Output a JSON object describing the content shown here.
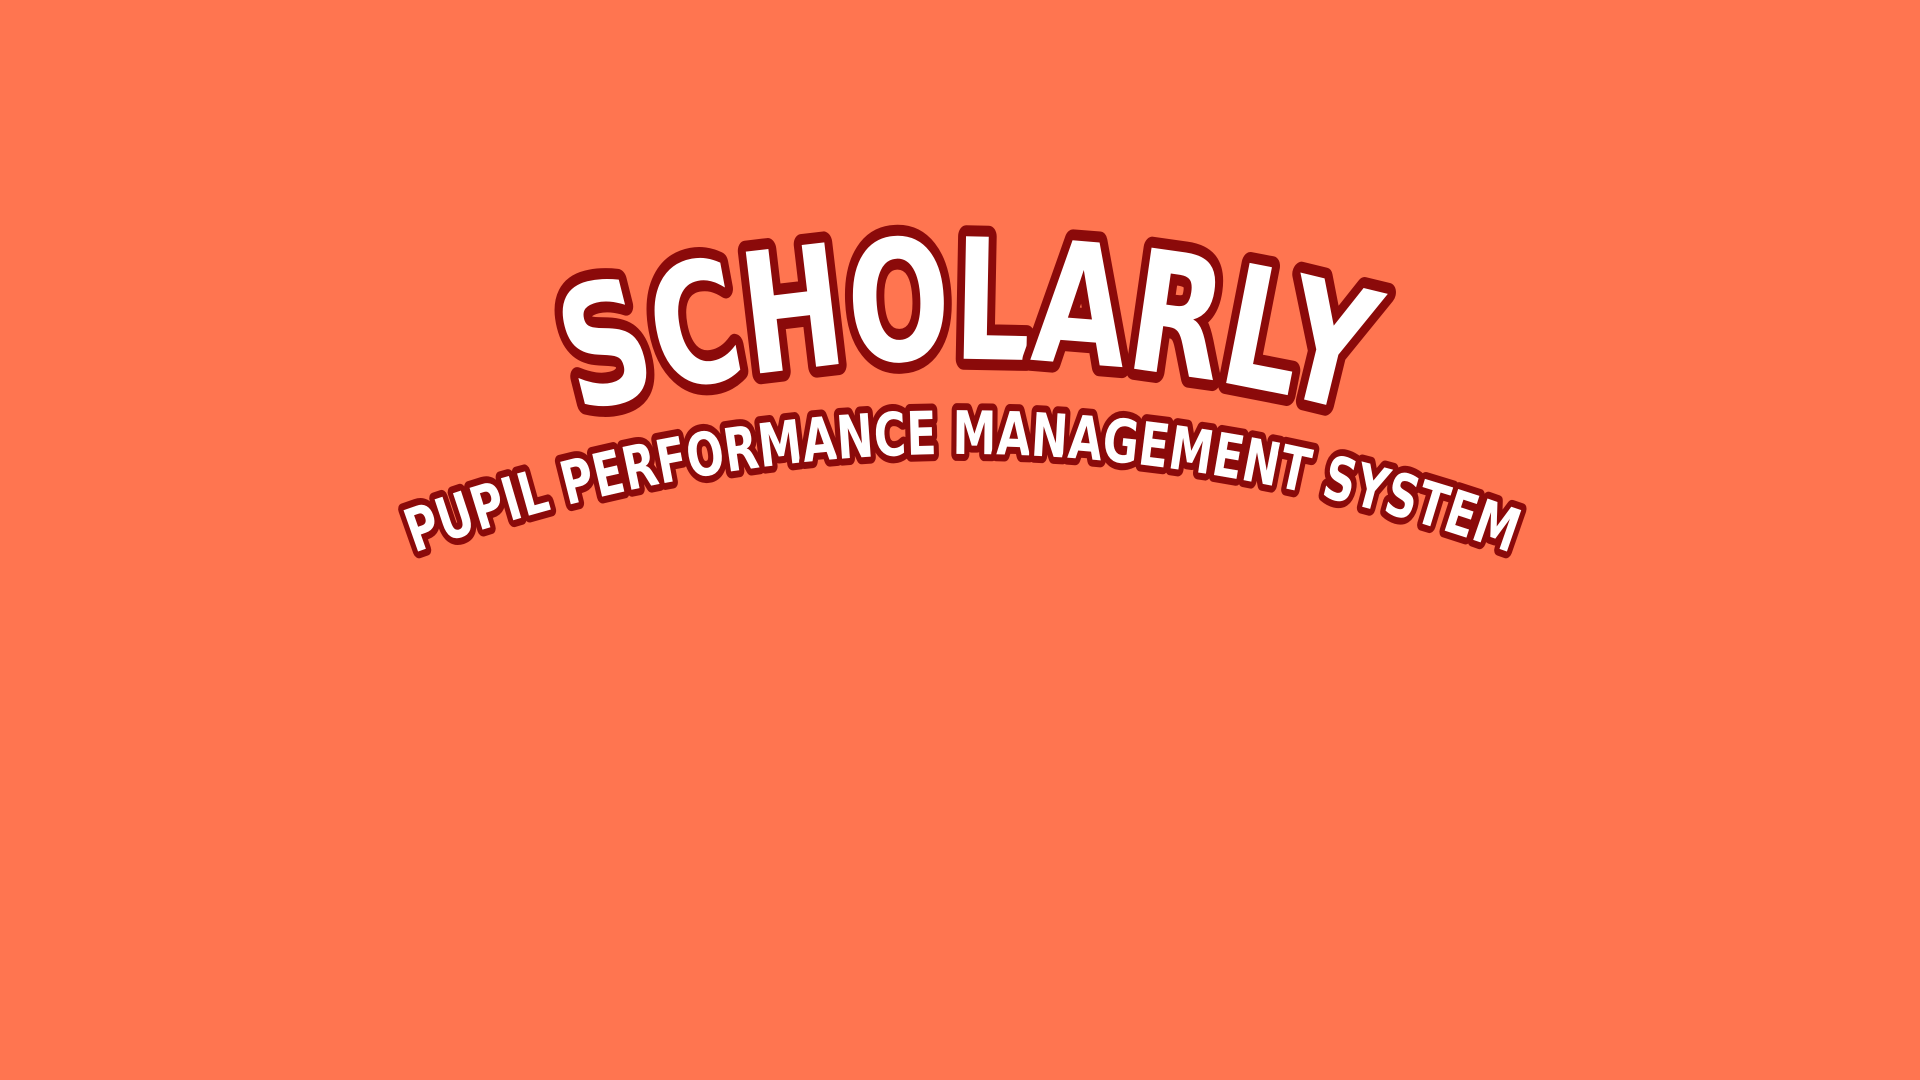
{
  "splash": {
    "title": "SCHOLARLY",
    "subtitle": "PUPIL PERFORMANCE MANAGEMENT SYSTEM",
    "colors": {
      "background": "#FF7550",
      "text_fill": "#FFFFFF",
      "text_outline": "#8B0A0A"
    }
  }
}
